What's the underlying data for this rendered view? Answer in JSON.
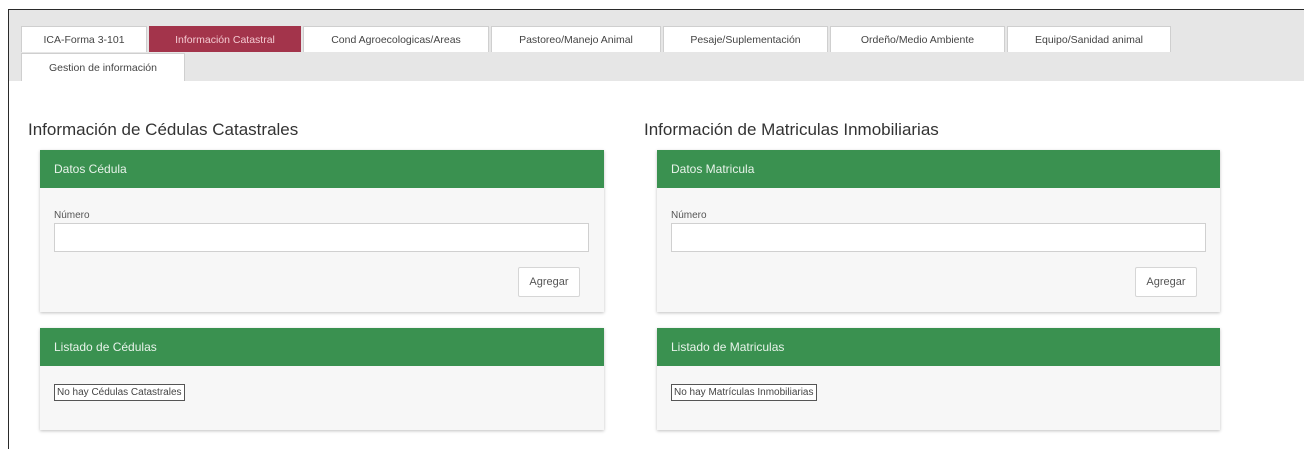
{
  "tabs": [
    {
      "label": "ICA-Forma 3-101",
      "active": false
    },
    {
      "label": "Información Catastral",
      "active": true
    },
    {
      "label": "Cond Agroecologicas/Areas",
      "active": false
    },
    {
      "label": "Pastoreo/Manejo Animal",
      "active": false
    },
    {
      "label": "Pesaje/Suplementación",
      "active": false
    },
    {
      "label": "Ordeño/Medio Ambiente",
      "active": false
    },
    {
      "label": "Equipo/Sanidad animal",
      "active": false
    },
    {
      "label": "Gestion de información",
      "active": false
    }
  ],
  "cedulas": {
    "title": "Información de Cédulas Catastrales",
    "form_header": "Datos Cédula",
    "field_label": "Número",
    "field_value": "",
    "add_label": "Agregar",
    "list_header": "Listado de Cédulas",
    "empty_message": "No hay Cédulas Catastrales"
  },
  "matriculas": {
    "title": "Información de Matriculas Inmobiliarias",
    "form_header": "Datos Matricula",
    "field_label": "Número",
    "field_value": "",
    "add_label": "Agregar",
    "list_header": "Listado de Matriculas",
    "empty_message": "No hay Matrículas Inmobiliarias"
  },
  "colors": {
    "active_tab": "#a3344b",
    "card_header": "#3a9150",
    "tab_bar": "#e6e6e6"
  }
}
